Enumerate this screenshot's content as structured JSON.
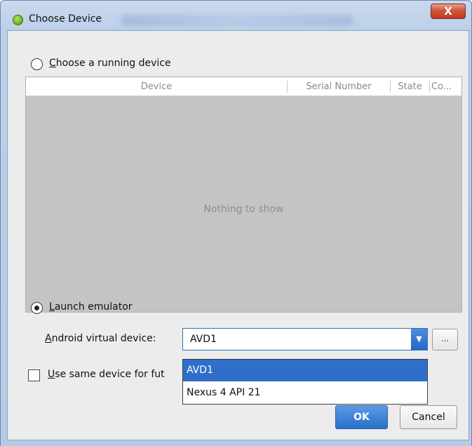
{
  "window": {
    "title": "Choose Device",
    "close_label": "X"
  },
  "running": {
    "label_first": "C",
    "label_rest": "hoose a running device",
    "selected": false
  },
  "table": {
    "columns": [
      "Device",
      "Serial Number",
      "State",
      "Co..."
    ],
    "empty_text": "Nothing to show"
  },
  "emulator": {
    "label_first": "L",
    "label_rest": "aunch emulator",
    "selected": true,
    "avd_label_first": "A",
    "avd_label_rest": "ndroid virtual device:",
    "avd_value": "AVD1",
    "more_label": "...",
    "options": [
      "AVD1",
      "Nexus 4 API 21"
    ],
    "selected_option": "AVD1"
  },
  "same_device": {
    "label_first": "U",
    "label_rest": "se same device for fut",
    "checked": false
  },
  "buttons": {
    "ok": "OK",
    "cancel": "Cancel"
  },
  "colors": {
    "accent": "#2f6fc9",
    "table_bg": "#c4c4c4",
    "close": "#c94a33"
  },
  "icons": {
    "app": "android-studio-icon",
    "dropdown": "chevron-down-icon"
  }
}
